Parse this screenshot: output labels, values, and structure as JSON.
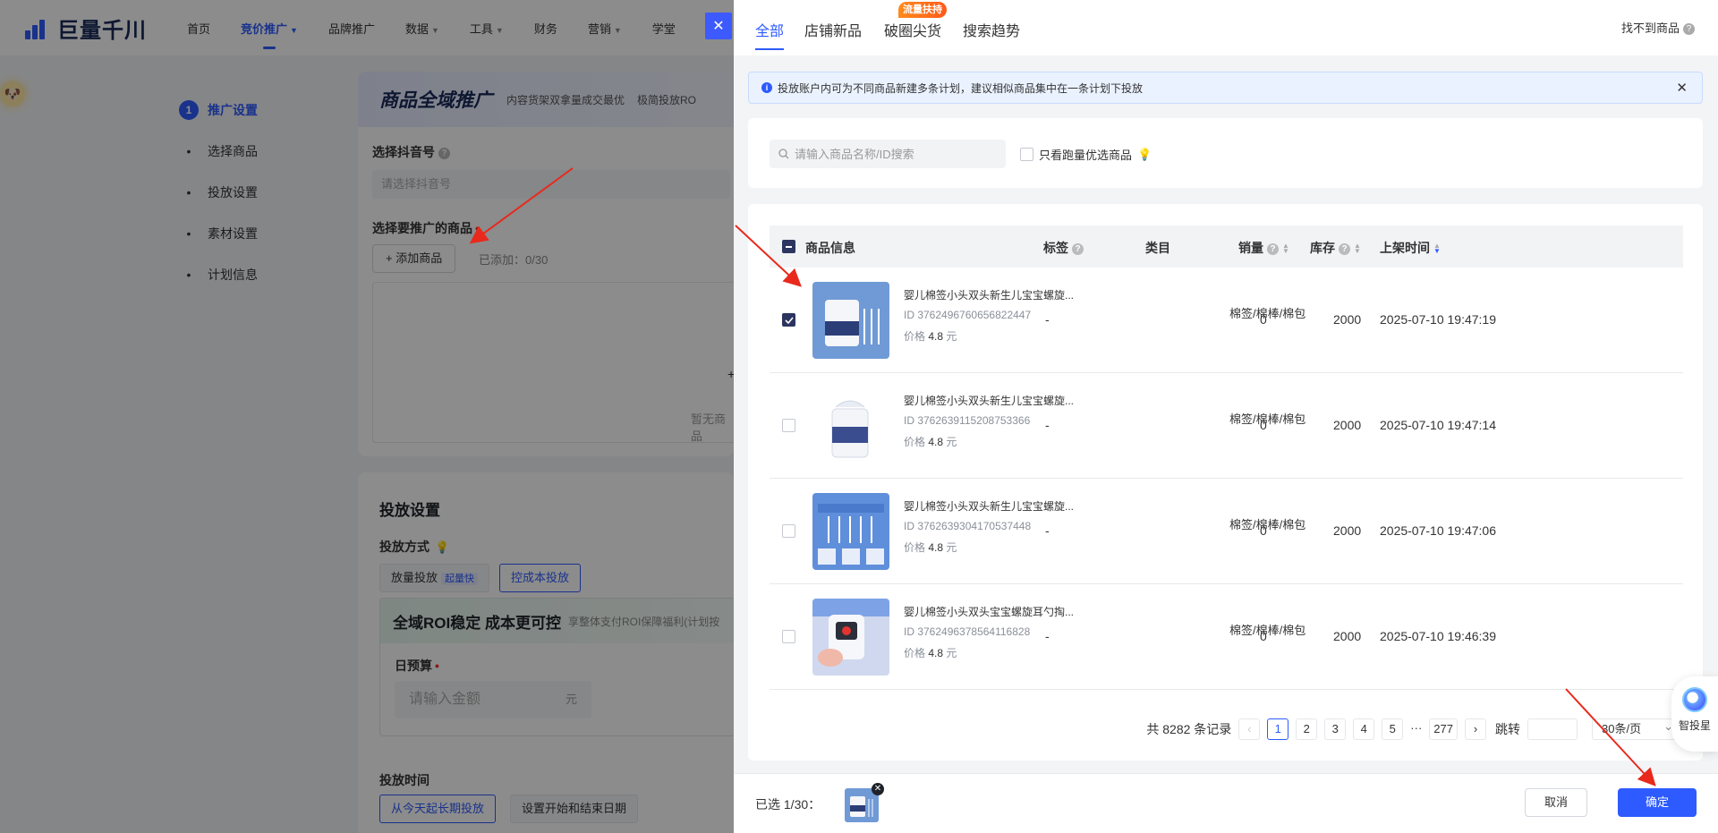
{
  "app": {
    "logo_text": "巨量千川",
    "nav": [
      {
        "label": "首页",
        "active": false,
        "caret": false
      },
      {
        "label": "竞价推广",
        "active": true,
        "caret": true
      },
      {
        "label": "品牌推广",
        "active": false,
        "caret": false
      },
      {
        "label": "数据",
        "active": false,
        "caret": true
      },
      {
        "label": "工具",
        "active": false,
        "caret": true
      },
      {
        "label": "财务",
        "active": false,
        "caret": false
      },
      {
        "label": "营销",
        "active": false,
        "caret": true
      },
      {
        "label": "学堂",
        "active": false,
        "caret": false
      }
    ],
    "steps": {
      "step1_num": "1",
      "step1": "推广设置",
      "step2": "选择商品",
      "step3": "投放设置",
      "step4": "素材设置",
      "step5": "计划信息"
    },
    "card1": {
      "title": "商品全域推广",
      "tag1": "内容货架双拿量成交最优",
      "tag2": "极简投放RO",
      "douyin_label": "选择抖音号",
      "douyin_placeholder": "请选择抖音号",
      "product_label": "选择要推广的商品",
      "add_button": "+ 添加商品",
      "added": "已添加：0/30",
      "empty_text": "暂无商品"
    },
    "card2": {
      "title": "投放设置",
      "method_label": "投放方式",
      "opt1": "放量投放",
      "opt1_badge": "起量快",
      "opt2": "控成本投放",
      "roi_title": "全域ROI稳定 成本更可控",
      "roi_sub": "享整体支付ROI保障福利(计划按",
      "budget_label": "日预算",
      "budget_placeholder": "请输入金额",
      "budget_unit": "元",
      "time_label": "投放时间",
      "time_opt1": "从今天起长期投放",
      "time_opt2": "设置开始和结束日期"
    }
  },
  "drawer": {
    "tabs": [
      {
        "label": "全部",
        "active": true
      },
      {
        "label": "店铺新品",
        "active": false
      },
      {
        "label": "破圈尖货",
        "active": false
      },
      {
        "label": "搜索趋势",
        "active": false
      }
    ],
    "hot_badge": "流量扶持",
    "no_product": "找不到商品",
    "notice": "投放账户内可为不同商品新建多条计划，建议相似商品集中在一条计划下投放",
    "search_placeholder": "请输入商品名称/ID搜索",
    "only_fast_label": "只看跑量优选商品",
    "columns": {
      "info": "商品信息",
      "tag": "标签",
      "category": "类目",
      "sales": "销量",
      "stock": "库存",
      "listed": "上架时间"
    },
    "rows": [
      {
        "name": "婴儿棉签小头双头新生儿宝宝螺旋...",
        "id": "ID 3762496760656822447",
        "price_label": "价格",
        "price": "4.8",
        "unit": "元",
        "tag": "-",
        "category": "棉签/棉棒/棉包",
        "sales": "0",
        "stock": "2000",
        "listed": "2025-07-10 19:47:19",
        "checked": true
      },
      {
        "name": "婴儿棉签小头双头新生儿宝宝螺旋...",
        "id": "ID 3762639115208753366",
        "price_label": "价格",
        "price": "4.8",
        "unit": "元",
        "tag": "-",
        "category": "棉签/棉棒/棉包",
        "sales": "0",
        "stock": "2000",
        "listed": "2025-07-10 19:47:14",
        "checked": false
      },
      {
        "name": "婴儿棉签小头双头新生儿宝宝螺旋...",
        "id": "ID 3762639304170537448",
        "price_label": "价格",
        "price": "4.8",
        "unit": "元",
        "tag": "-",
        "category": "棉签/棉棒/棉包",
        "sales": "0",
        "stock": "2000",
        "listed": "2025-07-10 19:47:06",
        "checked": false
      },
      {
        "name": "婴儿棉签小头双头宝宝螺旋耳勺掏...",
        "id": "ID 3762496378564116828",
        "price_label": "价格",
        "price": "4.8",
        "unit": "元",
        "tag": "-",
        "category": "棉签/棉棒/棉包",
        "sales": "0",
        "stock": "2000",
        "listed": "2025-07-10 19:46:39",
        "checked": false
      }
    ],
    "pagination": {
      "total": "共 8282 条记录",
      "pages": [
        "1",
        "2",
        "3",
        "4",
        "5"
      ],
      "ellipsis": "···",
      "last": "277",
      "jump": "跳转",
      "page_size": "30条/页",
      "current": "1"
    },
    "assistant": "智投星",
    "footer": {
      "selected": "已选 1/30：",
      "cancel": "取消",
      "confirm": "确定"
    }
  },
  "colors": {
    "primary": "#2e5bff",
    "checkbox_checked": "#2b3560",
    "annotation_arrow": "#e8291c"
  }
}
